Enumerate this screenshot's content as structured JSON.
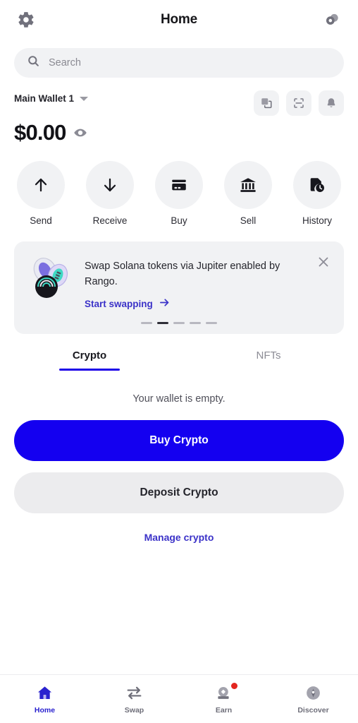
{
  "header": {
    "title": "Home",
    "settings_icon": "gear-icon",
    "connect_icon": "coins-icon"
  },
  "search": {
    "placeholder": "Search",
    "value": "",
    "icon": "search-icon"
  },
  "wallet": {
    "name": "Main Wallet 1",
    "dropdown_icon": "chevron-down-icon",
    "balance": "$0.00",
    "visibility_icon": "eye-icon",
    "tools": [
      {
        "name": "copy-address-button",
        "icon": "copy-icon"
      },
      {
        "name": "scan-qr-button",
        "icon": "qr-scan-icon"
      },
      {
        "name": "notifications-button",
        "icon": "bell-icon"
      }
    ]
  },
  "quick_actions": [
    {
      "label": "Send",
      "icon": "arrow-up-icon"
    },
    {
      "label": "Receive",
      "icon": "arrow-down-icon"
    },
    {
      "label": "Buy",
      "icon": "credit-card-icon"
    },
    {
      "label": "Sell",
      "icon": "bank-icon"
    },
    {
      "label": "History",
      "icon": "document-clock-icon"
    }
  ],
  "promo": {
    "title": "Swap Solana tokens via Jupiter enabled by Rango.",
    "link_label": "Start swapping",
    "link_arrow_icon": "arrow-right-icon",
    "close_icon": "close-icon",
    "art_icon": "swap-discs-illustration",
    "dots_total": 5,
    "dots_active_index": 1
  },
  "tabs": [
    {
      "label": "Crypto",
      "active": true
    },
    {
      "label": "NFTs",
      "active": false
    }
  ],
  "content": {
    "empty_message": "Your wallet is empty.",
    "buy_button": "Buy Crypto",
    "deposit_button": "Deposit Crypto",
    "manage_link": "Manage crypto"
  },
  "bottom_nav": [
    {
      "label": "Home",
      "icon": "home-icon",
      "active": true,
      "badge": false
    },
    {
      "label": "Swap",
      "icon": "swap-arrows-icon",
      "active": false,
      "badge": false
    },
    {
      "label": "Earn",
      "icon": "earn-gem-icon",
      "active": false,
      "badge": true
    },
    {
      "label": "Discover",
      "icon": "compass-icon",
      "active": false,
      "badge": false
    }
  ],
  "colors": {
    "accent_blue": "#1400f0",
    "link_blue": "#3b32c8",
    "surface_gray": "#f1f2f4",
    "badge_red": "#e3261f",
    "text_dark": "#16161a"
  }
}
